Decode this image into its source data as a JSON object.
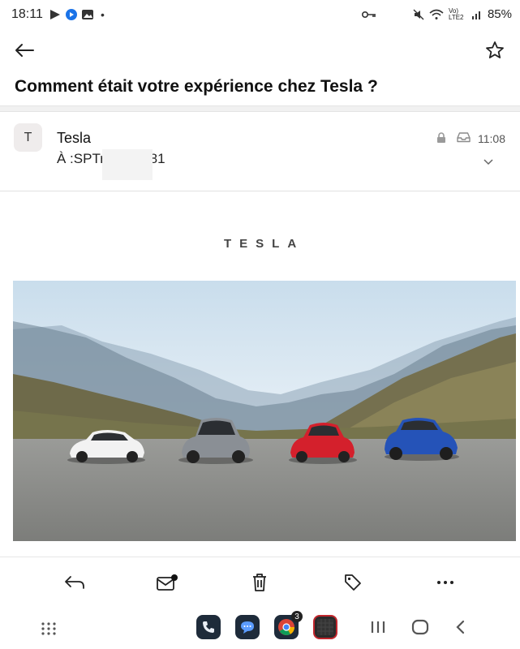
{
  "status_bar": {
    "time": "18:11",
    "battery": "85%",
    "network": "Vo) LTE2"
  },
  "email": {
    "subject": "Comment était votre expérience chez Tesla ?",
    "avatar_letter": "T",
    "sender": "Tesla",
    "recipient_prefix": "À :",
    "recipient": "SPTrophy1981",
    "time": "11:08"
  },
  "body": {
    "brand_logo": "TESLA"
  },
  "actions": [
    "reply",
    "mark-unread",
    "delete",
    "tag",
    "more"
  ],
  "dock": {
    "chrome_badge": "3"
  },
  "colors": {
    "accent": "#111111",
    "car_white": "#f2f2f2",
    "car_silver": "#8a8f95",
    "car_red": "#d4202c",
    "car_blue": "#2553b8"
  }
}
